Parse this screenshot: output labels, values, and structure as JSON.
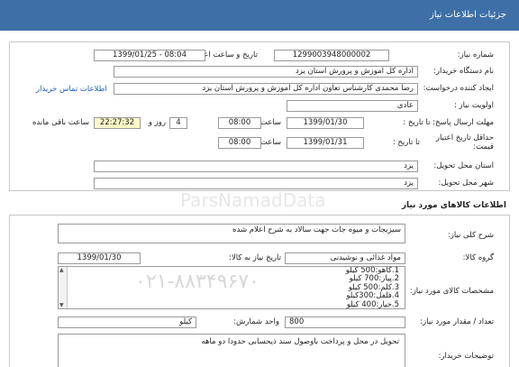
{
  "header": {
    "title": "جزئیات اطلاعات نیاز"
  },
  "need_info": {
    "need_number_label": "شماره نیاز:",
    "need_number": "1299003948000002",
    "announce_label": "تاریخ و ساعت اعلان عمومی:",
    "announce_value": "1399/01/25 - 08:04",
    "buyer_label": "نام دستگاه خریدار:",
    "buyer_value": "اداره کل آموزش و پرورش استان یزد",
    "creator_label": "ایجاد کننده درخواست:",
    "creator_value": "رضا محمدی کارشناس تعاون اداره کل آموزش و پرورش استان یزد",
    "contact_link": "اطلاعات تماس خریدار",
    "priority_label": "اولویت نیاز :",
    "priority_value": "عادی",
    "deadline_label": "مهلت ارسال پاسخ: تا تاریخ :",
    "deadline_date": "1399/01/30",
    "time_label": "ساعت",
    "deadline_time": "08:00",
    "days_value": "4",
    "days_label": "روز و",
    "remaining_time": "22:27:32",
    "remaining_label": "ساعت باقی مانده",
    "validity_label_1": "حداقل تاریخ اعتبار",
    "validity_label_2": "قیمت:",
    "validity_until": "تا تاریخ :",
    "validity_date": "1399/01/31",
    "validity_time": "08:00",
    "province_label": "استان محل تحویل:",
    "province_value": "یزد",
    "city_label": "شهر محل تحویل:",
    "city_value": "یزد"
  },
  "goods": {
    "section_title": "اطلاعات کالاهای مورد نیاز",
    "summary_label": "شرح کلی نیاز:",
    "summary_value": "سبزیجات و میوه جات جهت سالاد به شرح اعلام شده",
    "group_label": "گروه کالا:",
    "group_value": "مواد غذائی و نوشیدنی",
    "need_date_label": "تاریخ نیاز به کالا:",
    "need_date_value": "1399/01/30",
    "specs_label": "مشخصات کالای مورد نیاز:",
    "specs_items": [
      "1.کاهو:500 کیلو",
      "2.پیاز:700 کیلو",
      "3.کلم:500 کیلو",
      "4.فلفل:300کیلو",
      "5.خیار:400 کیلو"
    ],
    "qty_label": "تعداد / مقدار مورد نیاز:",
    "qty_value": "800",
    "unit_label": "واحد شمارش:",
    "unit_value": "کیلو",
    "desc_label": "توضیحات خریدار:",
    "desc_value": "تحویل در محل و پرداخت باوصول سند ذیحسابی حدودا دو ماهه"
  },
  "watermark": {
    "text": "ParsNamadData",
    "phone": "۰۲۱-۸۸۳۴۹۶۷۰"
  }
}
